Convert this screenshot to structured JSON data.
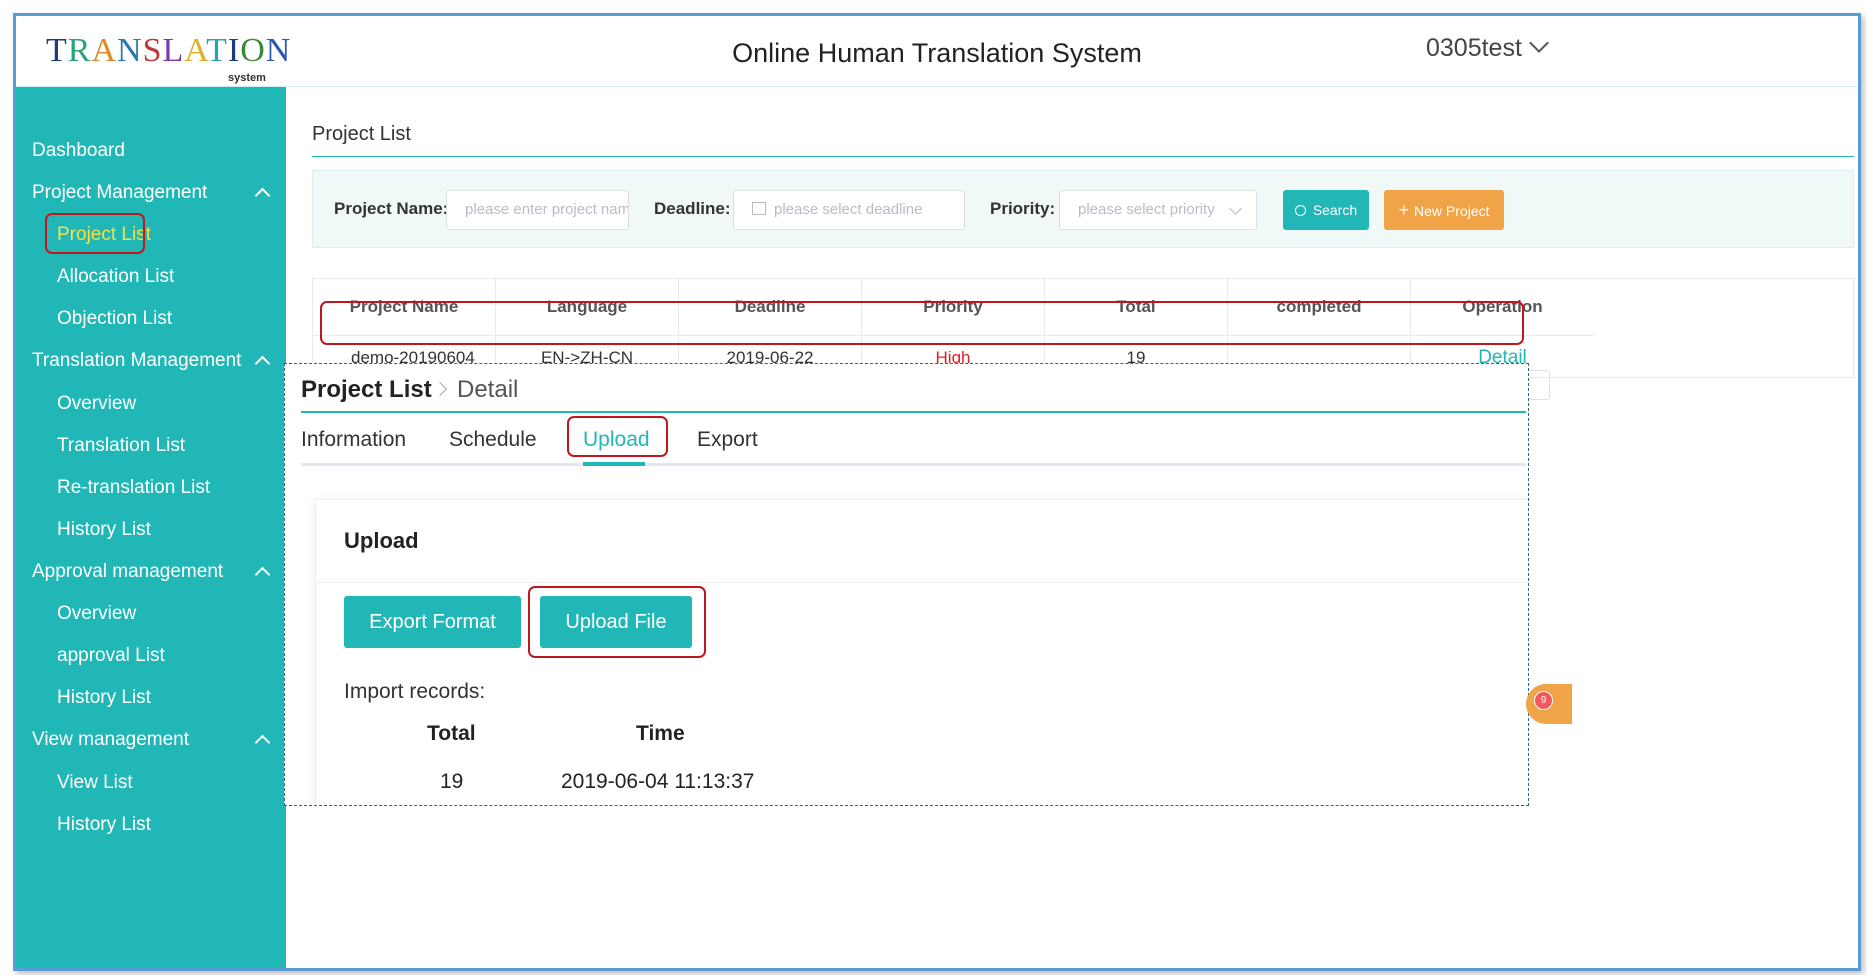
{
  "header": {
    "logo_text": "TRANSLATION",
    "logo_sub": "system",
    "title": "Online Human Translation System",
    "username": "0305test"
  },
  "sidebar": {
    "items": [
      {
        "label": "Dashboard",
        "level": 1
      },
      {
        "label": "Project Management",
        "level": 1,
        "expanded": true
      },
      {
        "label": "Project List",
        "level": 2,
        "active": true
      },
      {
        "label": "Allocation List",
        "level": 2
      },
      {
        "label": "Objection List",
        "level": 2
      },
      {
        "label": "Translation Management",
        "level": 1,
        "expanded": true
      },
      {
        "label": "Overview",
        "level": 2
      },
      {
        "label": "Translation List",
        "level": 2
      },
      {
        "label": "Re-translation List",
        "level": 2
      },
      {
        "label": "History List",
        "level": 2
      },
      {
        "label": "Approval management",
        "level": 1,
        "expanded": true
      },
      {
        "label": "Overview",
        "level": 2
      },
      {
        "label": "approval List",
        "level": 2
      },
      {
        "label": "History List",
        "level": 2
      },
      {
        "label": "View management",
        "level": 1,
        "expanded": true
      },
      {
        "label": "View List",
        "level": 2
      },
      {
        "label": "History List",
        "level": 2
      }
    ]
  },
  "main": {
    "breadcrumb": "Project List",
    "filter": {
      "project_name_label": "Project Name:",
      "project_name_placeholder": "please enter project nam",
      "deadline_label": "Deadline:",
      "deadline_placeholder": "please select deadline",
      "priority_label": "Priority:",
      "priority_placeholder": "please select priority",
      "search_label": "Search",
      "new_project_label": "New Project"
    },
    "table": {
      "headers": [
        "Project Name",
        "Language",
        "Deadline",
        "Priority",
        "Total",
        "completed",
        "Operation"
      ],
      "rows": [
        {
          "project_name": "demo-20190604",
          "language": "EN->ZH-CN",
          "deadline": "2019-06-22",
          "priority": "High",
          "total": "19",
          "completed": "",
          "operation": "Detail"
        }
      ]
    }
  },
  "detail": {
    "crumb_parent": "Project List",
    "crumb_current": "Detail",
    "tabs": [
      "Information",
      "Schedule",
      "Upload",
      "Export"
    ],
    "active_tab": "Upload",
    "card_title": "Upload",
    "export_format_label": "Export Format",
    "upload_file_label": "Upload File",
    "records_label": "Import records:",
    "records_headers": [
      "Total",
      "Time"
    ],
    "records": [
      {
        "total": "19",
        "time": "2019-06-04 11:13:37"
      }
    ]
  },
  "floating": {
    "badge": "9"
  },
  "colors": {
    "accent": "#22b7b7",
    "orange": "#f0a447",
    "highlight": "#c0161e",
    "priority_high": "#e02020"
  }
}
